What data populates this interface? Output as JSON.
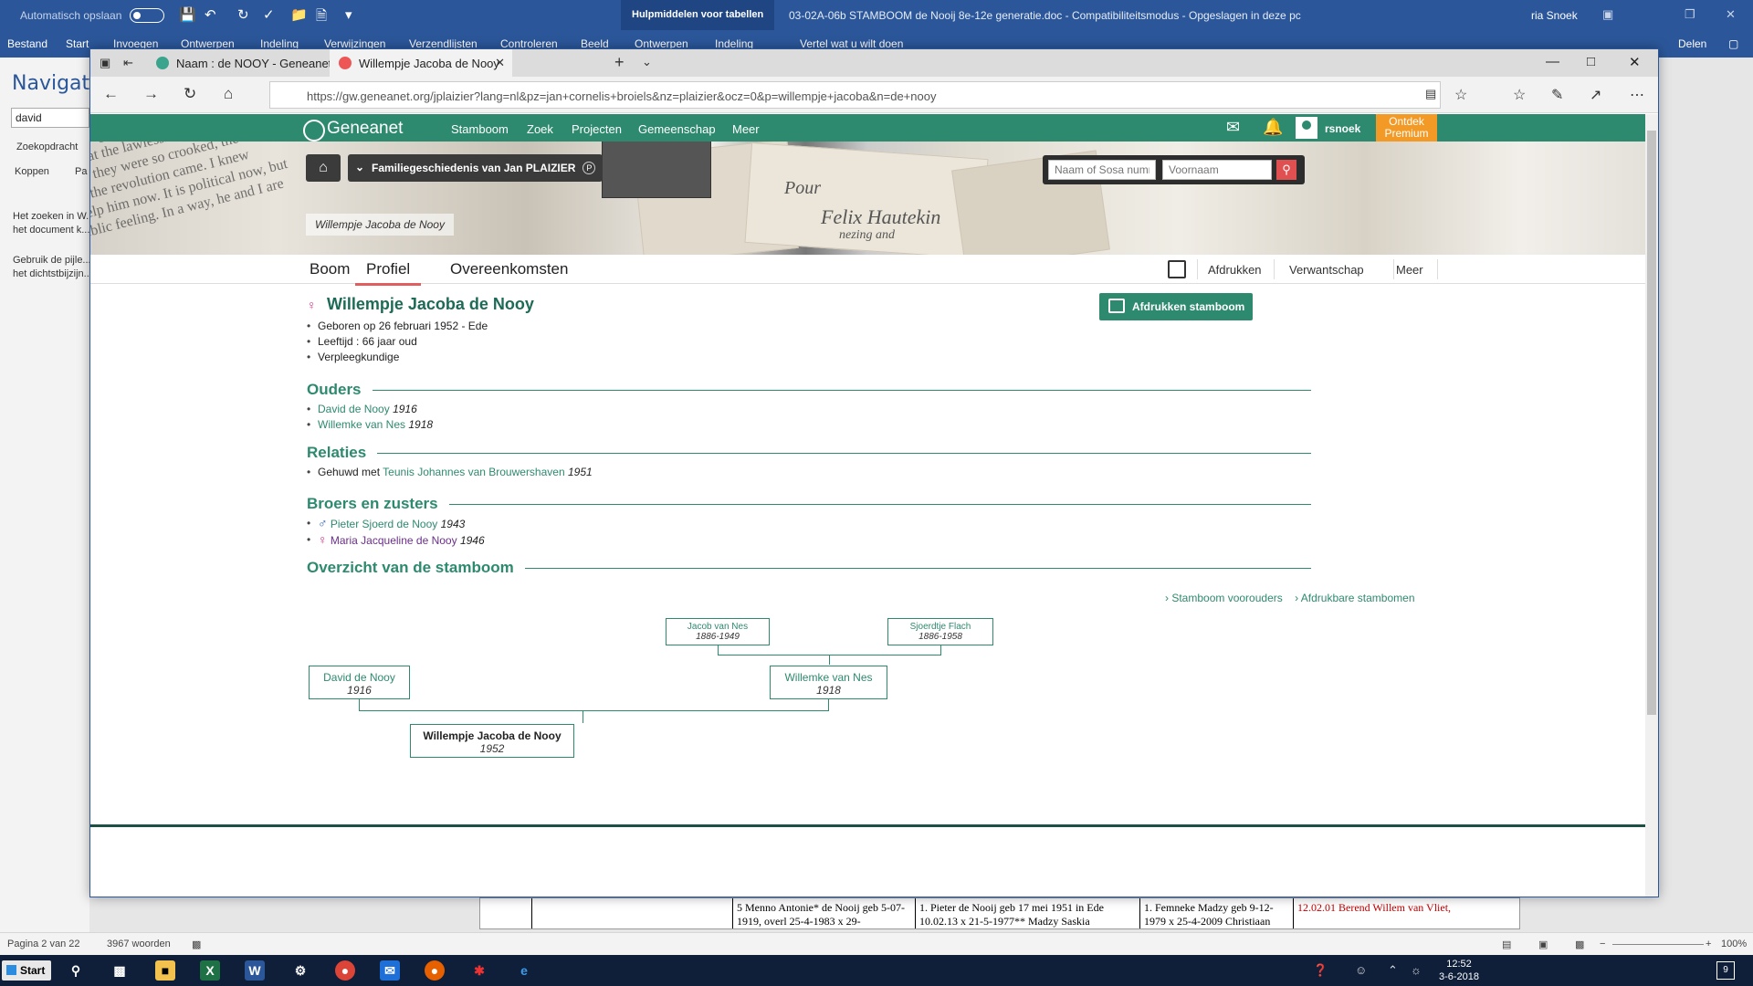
{
  "word": {
    "autosave_label": "Automatisch opslaan",
    "context_tab": "Hulpmiddelen voor tabellen",
    "doc_title": "03-02A-06b STAMBOOM de Nooij 8e-12e generatie.doc  -  Compatibiliteitsmodus  -  Opgeslagen in deze pc",
    "user": "ria Snoek",
    "ribbon_tabs": [
      "Bestand",
      "Start",
      "Invoegen",
      "Ontwerpen",
      "Indeling",
      "Verwijzingen",
      "Verzendlijsten",
      "Controleren",
      "Beeld",
      "Ontwerpen",
      "Indeling"
    ],
    "tell_me": "Vertel wat u wilt doen",
    "share": "Delen",
    "nav_title": "Navigatie",
    "nav_search_value": "david",
    "nav_tabs": [
      "Zoekopdracht",
      "Koppen",
      "Pa"
    ],
    "nav_hint_1": "Het zoeken in W...",
    "nav_hint_2": "het document k...",
    "nav_hint_3": "Gebruik de pijle...",
    "nav_hint_4": "het dichtstbijzijn...",
    "table_cells": [
      "5  Menno Antonie* de Nooij geb 5-07-1919, overl 25-4-1983  x 29-",
      "1. Pieter de Nooij  geb 17 mei 1951 in Ede 10.02.13  x 21-5-1977**  Madzy Saskia",
      "1. Femneke Madzy geb 9-12-1979 x 25-4-2009 Christiaan",
      "12.02.01 Berend Willem van Vliet,"
    ],
    "status_page": "Pagina 2 van 22",
    "status_words": "3967 woorden",
    "zoom": "100%"
  },
  "taskbar": {
    "start_label": "Start",
    "time": "12:52",
    "date": "3-6-2018",
    "notifications": "9"
  },
  "browser": {
    "tabs": [
      {
        "title": "Naam : de NOOY - Geneanet"
      },
      {
        "title": "Willempje Jacoba de Nooy"
      }
    ],
    "url": "https://gw.geneanet.org/jplaizier?lang=nl&pz=jan+cornelis+broiels&nz=plaizier&ocz=0&p=willempje+jacoba&n=de+nooy"
  },
  "geneanet": {
    "logo": "Geneanet",
    "menu": [
      "Stamboom",
      "Zoek",
      "Projecten",
      "Gemeenschap",
      "Meer"
    ],
    "username": "rsnoek",
    "premium_1": "Ontdek",
    "premium_2": "Premium",
    "family_label": "Familiegeschiedenis van Jan PLAIZIER",
    "family_badge": "P",
    "breadcrumb": "Willempje Jacoba de Nooy",
    "search_name_placeholder": "Naam of Sosa nummer",
    "search_firstname_placeholder": "Voornaam",
    "subtabs": [
      "Boom",
      "Profiel",
      "Overeenkomsten"
    ],
    "subtabs_right": [
      "Afdrukken",
      "Verwantschap",
      "Meer"
    ],
    "colors": {
      "green": "#2e8a6f",
      "female": "#d63384",
      "male": "#2a5db0",
      "premium": "#f39a26",
      "active_tab": "#e25d5d"
    }
  },
  "person": {
    "name": "Willempje Jacoba de Nooy",
    "gender_symbol": "♀",
    "print_button": "Afdrukken stamboom",
    "facts": [
      "Geboren op 26 februari 1952 - Ede",
      "Leeftijd : 66 jaar oud",
      "Verpleegkundige"
    ],
    "sections": {
      "parents": "Ouders",
      "relations": "Relaties",
      "siblings": "Broers en zusters",
      "overview": "Overzicht van de stamboom"
    },
    "parents": [
      {
        "name": "David de Nooy",
        "year": "1916"
      },
      {
        "name": "Willemke van Nes",
        "year": "1918"
      }
    ],
    "relation": {
      "prefix": "Gehuwd met",
      "name": "Teunis Johannes van Brouwershaven",
      "year": "1951"
    },
    "siblings": [
      {
        "symbol": "♂",
        "name": "Pieter Sjoerd de Nooy",
        "year": "1943"
      },
      {
        "symbol": "♀",
        "name": "Maria Jacqueline de Nooy",
        "year": "1946"
      }
    ],
    "tree_links": [
      "Stamboom voorouders",
      "Afdrukbare stambomen"
    ],
    "tree": {
      "grandfather": {
        "name": "Jacob van Nes",
        "years": "1886-1949"
      },
      "grandmother": {
        "name": "Sjoerdtje Flach",
        "years": "1886-1958"
      },
      "father": {
        "name": "David de Nooy",
        "years": "1916"
      },
      "mother": {
        "name": "Willemke van Nes",
        "years": "1918"
      },
      "self": {
        "name": "Willempje Jacoba de Nooy",
        "years": "1952"
      }
    }
  }
}
